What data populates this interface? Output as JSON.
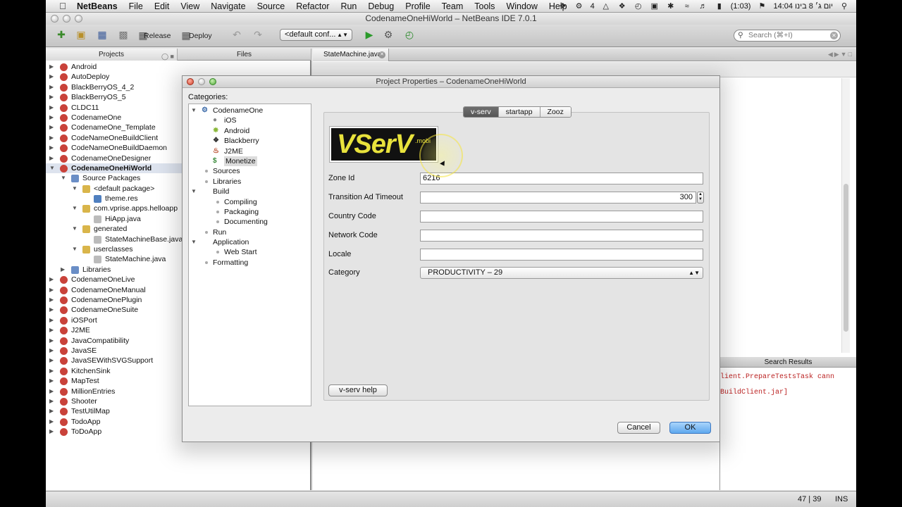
{
  "menubar": {
    "app_name": "NetBeans",
    "items": [
      "File",
      "Edit",
      "View",
      "Navigate",
      "Source",
      "Refactor",
      "Run",
      "Debug",
      "Profile",
      "Team",
      "Tools",
      "Window",
      "Help"
    ],
    "battery": "(1:03)",
    "date_time": "יום ג׳ 8 בינו 14:04",
    "tray_count": "4"
  },
  "window": {
    "title": "CodenameOneHiWorld – NetBeans IDE 7.0.1"
  },
  "toolbar": {
    "release_label": "Release",
    "deploy_label": "Deploy",
    "config_value": "<default conf...",
    "search_placeholder": "Search (⌘+I)"
  },
  "left_panel": {
    "tabs": [
      "Projects",
      "Files"
    ],
    "tree": [
      {
        "label": "Android",
        "level": 0,
        "exp": "collapsed",
        "icon": "project-icon"
      },
      {
        "label": "AutoDeploy",
        "level": 0,
        "exp": "collapsed",
        "icon": "project-icon"
      },
      {
        "label": "BlackBerryOS_4_2",
        "level": 0,
        "exp": "collapsed",
        "icon": "project-icon"
      },
      {
        "label": "BlackBerryOS_5",
        "level": 0,
        "exp": "collapsed",
        "icon": "project-icon"
      },
      {
        "label": "CLDC11",
        "level": 0,
        "exp": "collapsed",
        "icon": "project-icon"
      },
      {
        "label": "CodenameOne",
        "level": 0,
        "exp": "collapsed",
        "icon": "project-icon"
      },
      {
        "label": "CodenameOne_Template",
        "level": 0,
        "exp": "collapsed",
        "icon": "project-icon"
      },
      {
        "label": "CodeNameOneBuildClient",
        "level": 0,
        "exp": "collapsed",
        "icon": "project-icon"
      },
      {
        "label": "CodeNameOneBuildDaemon",
        "level": 0,
        "exp": "collapsed",
        "icon": "project-icon"
      },
      {
        "label": "CodenameOneDesigner",
        "level": 0,
        "exp": "collapsed",
        "icon": "project-icon"
      },
      {
        "label": "CodenameOneHiWorld",
        "level": 0,
        "exp": "expanded",
        "icon": "project-icon",
        "selected": true
      },
      {
        "label": "Source Packages",
        "level": 1,
        "exp": "expanded",
        "icon": "folder-icon"
      },
      {
        "label": "<default package>",
        "level": 2,
        "exp": "expanded",
        "icon": "package-icon"
      },
      {
        "label": "theme.res",
        "level": 3,
        "exp": "none",
        "icon": "resource-file-icon"
      },
      {
        "label": "com.vprise.apps.helloapp",
        "level": 2,
        "exp": "expanded",
        "icon": "package-icon"
      },
      {
        "label": "HiApp.java",
        "level": 3,
        "exp": "none",
        "icon": "java-file-icon"
      },
      {
        "label": "generated",
        "level": 2,
        "exp": "expanded",
        "icon": "package-icon"
      },
      {
        "label": "StateMachineBase.java",
        "level": 3,
        "exp": "none",
        "icon": "java-file-icon"
      },
      {
        "label": "userclasses",
        "level": 2,
        "exp": "expanded",
        "icon": "package-icon"
      },
      {
        "label": "StateMachine.java",
        "level": 3,
        "exp": "none",
        "icon": "java-file-icon"
      },
      {
        "label": "Libraries",
        "level": 1,
        "exp": "collapsed",
        "icon": "folder-icon"
      },
      {
        "label": "CodenameOneLive",
        "level": 0,
        "exp": "collapsed",
        "icon": "project-icon"
      },
      {
        "label": "CodenameOneManual",
        "level": 0,
        "exp": "collapsed",
        "icon": "project-icon"
      },
      {
        "label": "CodenameOnePlugin",
        "level": 0,
        "exp": "collapsed",
        "icon": "project-icon"
      },
      {
        "label": "CodenameOneSuite",
        "level": 0,
        "exp": "collapsed",
        "icon": "project-icon"
      },
      {
        "label": "iOSPort",
        "level": 0,
        "exp": "collapsed",
        "icon": "project-icon"
      },
      {
        "label": "J2ME",
        "level": 0,
        "exp": "collapsed",
        "icon": "project-icon"
      },
      {
        "label": "JavaCompatibility",
        "level": 0,
        "exp": "collapsed",
        "icon": "project-icon"
      },
      {
        "label": "JavaSE",
        "level": 0,
        "exp": "collapsed",
        "icon": "project-icon"
      },
      {
        "label": "JavaSEWithSVGSupport",
        "level": 0,
        "exp": "collapsed",
        "icon": "project-icon"
      },
      {
        "label": "KitchenSink",
        "level": 0,
        "exp": "collapsed",
        "icon": "project-icon"
      },
      {
        "label": "MapTest",
        "level": 0,
        "exp": "collapsed",
        "icon": "project-icon"
      },
      {
        "label": "MillionEntries",
        "level": 0,
        "exp": "collapsed",
        "icon": "project-icon"
      },
      {
        "label": "Shooter",
        "level": 0,
        "exp": "collapsed",
        "icon": "project-icon"
      },
      {
        "label": "TestUtilMap",
        "level": 0,
        "exp": "collapsed",
        "icon": "project-icon"
      },
      {
        "label": "TodoApp",
        "level": 0,
        "exp": "collapsed",
        "icon": "project-icon"
      },
      {
        "label": "ToDoApp",
        "level": 0,
        "exp": "collapsed",
        "icon": "project-icon"
      }
    ]
  },
  "editor": {
    "tab_label": "StateMachine.java"
  },
  "search_results": {
    "title": "Search Results",
    "lines": [
      "lient.PrepareTestsTask cann",
      "BuildClient.jar]"
    ]
  },
  "status_bar": {
    "position": "47 | 39",
    "mode": "INS"
  },
  "dialog": {
    "title": "Project Properties – CodenameOneHiWorld",
    "categories_label": "Categories:",
    "categories": [
      {
        "label": "CodenameOne",
        "level": 0,
        "exp": "expanded",
        "icon": "codenameone-icon"
      },
      {
        "label": "iOS",
        "level": 1,
        "exp": "none",
        "icon": "apple-icon"
      },
      {
        "label": "Android",
        "level": 1,
        "exp": "none",
        "icon": "android-icon"
      },
      {
        "label": "Blackberry",
        "level": 1,
        "exp": "none",
        "icon": "blackberry-icon"
      },
      {
        "label": "J2ME",
        "level": 1,
        "exp": "none",
        "icon": "java-icon"
      },
      {
        "label": "Monetize",
        "level": 1,
        "exp": "none",
        "icon": "dollar-icon",
        "selected": true
      },
      {
        "label": "Sources",
        "level": 0,
        "exp": "none",
        "icon": "bullet"
      },
      {
        "label": "Libraries",
        "level": 0,
        "exp": "none",
        "icon": "bullet"
      },
      {
        "label": "Build",
        "level": 0,
        "exp": "expanded",
        "icon": "none"
      },
      {
        "label": "Compiling",
        "level": 1,
        "exp": "none",
        "icon": "bullet"
      },
      {
        "label": "Packaging",
        "level": 1,
        "exp": "none",
        "icon": "bullet"
      },
      {
        "label": "Documenting",
        "level": 1,
        "exp": "none",
        "icon": "bullet"
      },
      {
        "label": "Run",
        "level": 0,
        "exp": "none",
        "icon": "bullet"
      },
      {
        "label": "Application",
        "level": 0,
        "exp": "expanded",
        "icon": "none"
      },
      {
        "label": "Web Start",
        "level": 1,
        "exp": "none",
        "icon": "bullet"
      },
      {
        "label": "Formatting",
        "level": 0,
        "exp": "none",
        "icon": "bullet"
      }
    ],
    "tabs": [
      {
        "label": "v-serv",
        "active": true
      },
      {
        "label": "startapp",
        "active": false
      },
      {
        "label": "Zooz",
        "active": false
      }
    ],
    "logo": {
      "main": "VSerV",
      "suffix": ".mobi"
    },
    "fields": {
      "zone_id": {
        "label": "Zone Id",
        "value": "6216"
      },
      "transition_timeout": {
        "label": "Transition Ad Timeout",
        "value": "300"
      },
      "country_code": {
        "label": "Country Code",
        "value": ""
      },
      "network_code": {
        "label": "Network Code",
        "value": ""
      },
      "locale": {
        "label": "Locale",
        "value": ""
      },
      "category": {
        "label": "Category",
        "value": "PRODUCTIVITY – 29"
      }
    },
    "help_button": "v-serv help",
    "cancel_button": "Cancel",
    "ok_button": "OK"
  },
  "colors": {
    "accent_blue": "#5ea8ee",
    "logo_yellow": "#e8e23c",
    "error_red": "#bb2222"
  }
}
